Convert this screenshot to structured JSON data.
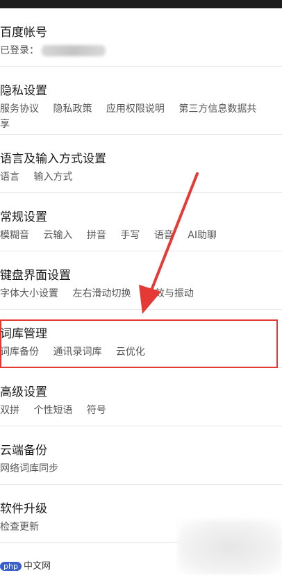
{
  "rows": [
    {
      "title": "百度帐号",
      "subs": [
        "已登录："
      ]
    },
    {
      "title": "隐私设置",
      "subs": [
        "服务协议",
        "隐私政策",
        "应用权限说明",
        "第三方信息数据共"
      ],
      "wrap": "享"
    },
    {
      "title": "语言及输入方式设置",
      "subs": [
        "语言",
        "输入方式"
      ]
    },
    {
      "title": "常规设置",
      "subs": [
        "模糊音",
        "云输入",
        "拼音",
        "手写",
        "语音",
        "AI助聊"
      ]
    },
    {
      "title": "键盘界面设置",
      "subs": [
        "字体大小设置",
        "左右滑动切换",
        "音效与振动"
      ]
    },
    {
      "title": "词库管理",
      "subs": [
        "词库备份",
        "通讯录词库",
        "云优化"
      ]
    },
    {
      "title": "高级设置",
      "subs": [
        "双拼",
        "个性短语",
        "符号"
      ]
    },
    {
      "title": "云端备份",
      "subs": [
        "网络词库同步"
      ]
    },
    {
      "title": "软件升级",
      "subs": [
        "检查更新"
      ]
    }
  ],
  "watermark": {
    "badge": "php",
    "text": "中文网"
  },
  "colors": {
    "highlight": "#e53935"
  }
}
